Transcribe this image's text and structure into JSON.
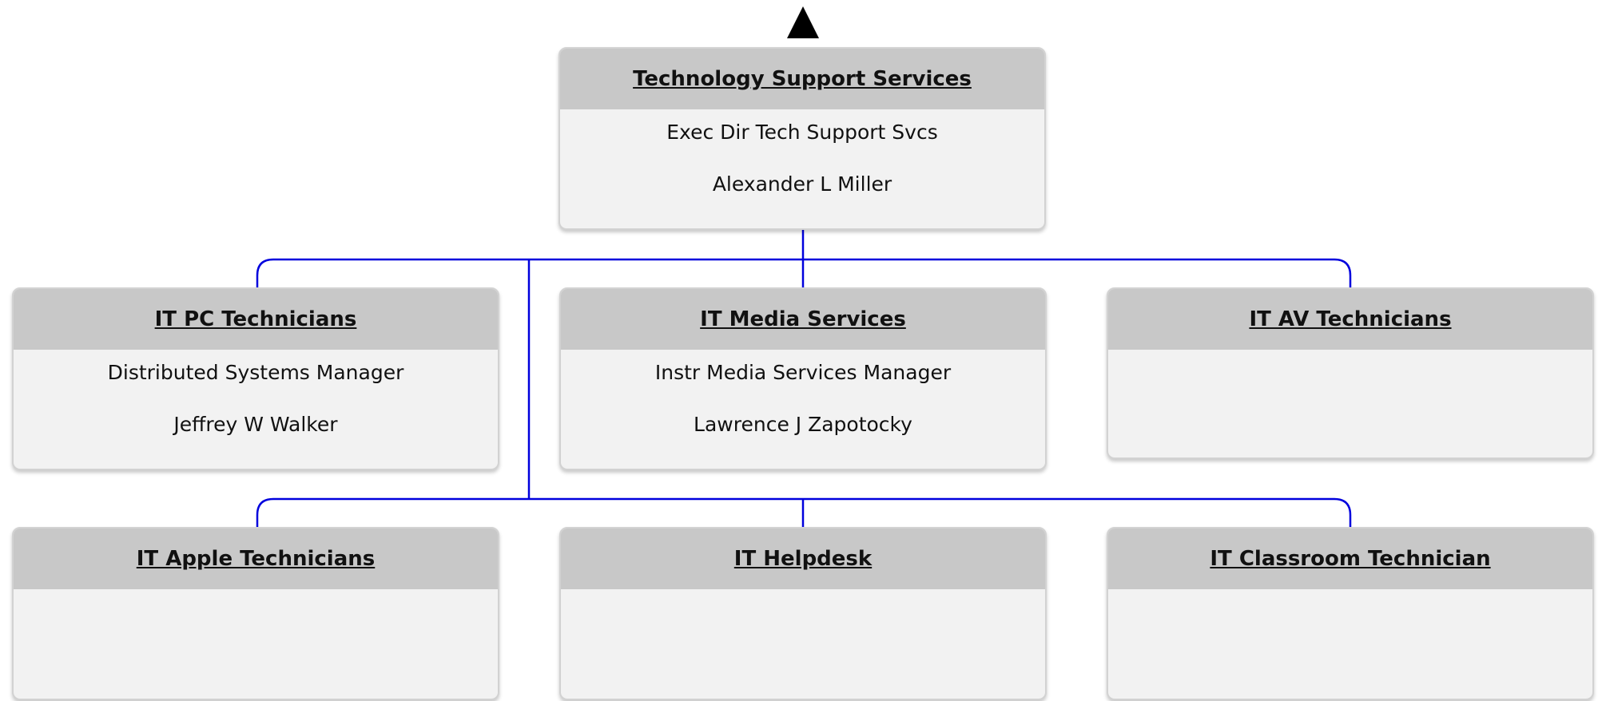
{
  "org_chart": {
    "connector_color": "#0000dd",
    "header_color": "#c8c8c8",
    "body_color": "#f2f2f2",
    "root": {
      "title": "Technology Support Services",
      "role": "Exec Dir Tech Support Svcs",
      "person": "Alexander L Miller"
    },
    "units": [
      {
        "title": "IT PC Technicians",
        "role": "Distributed Systems Manager",
        "person": "Jeffrey W Walker"
      },
      {
        "title": "IT Media Services",
        "role": "Instr Media Services Manager",
        "person": "Lawrence J Zapotocky"
      },
      {
        "title": "IT AV Technicians",
        "role": "",
        "person": ""
      },
      {
        "title": "IT Apple Technicians",
        "role": "",
        "person": ""
      },
      {
        "title": "IT Helpdesk",
        "role": "",
        "person": ""
      },
      {
        "title": "IT Classroom Technician",
        "role": "",
        "person": ""
      }
    ]
  }
}
